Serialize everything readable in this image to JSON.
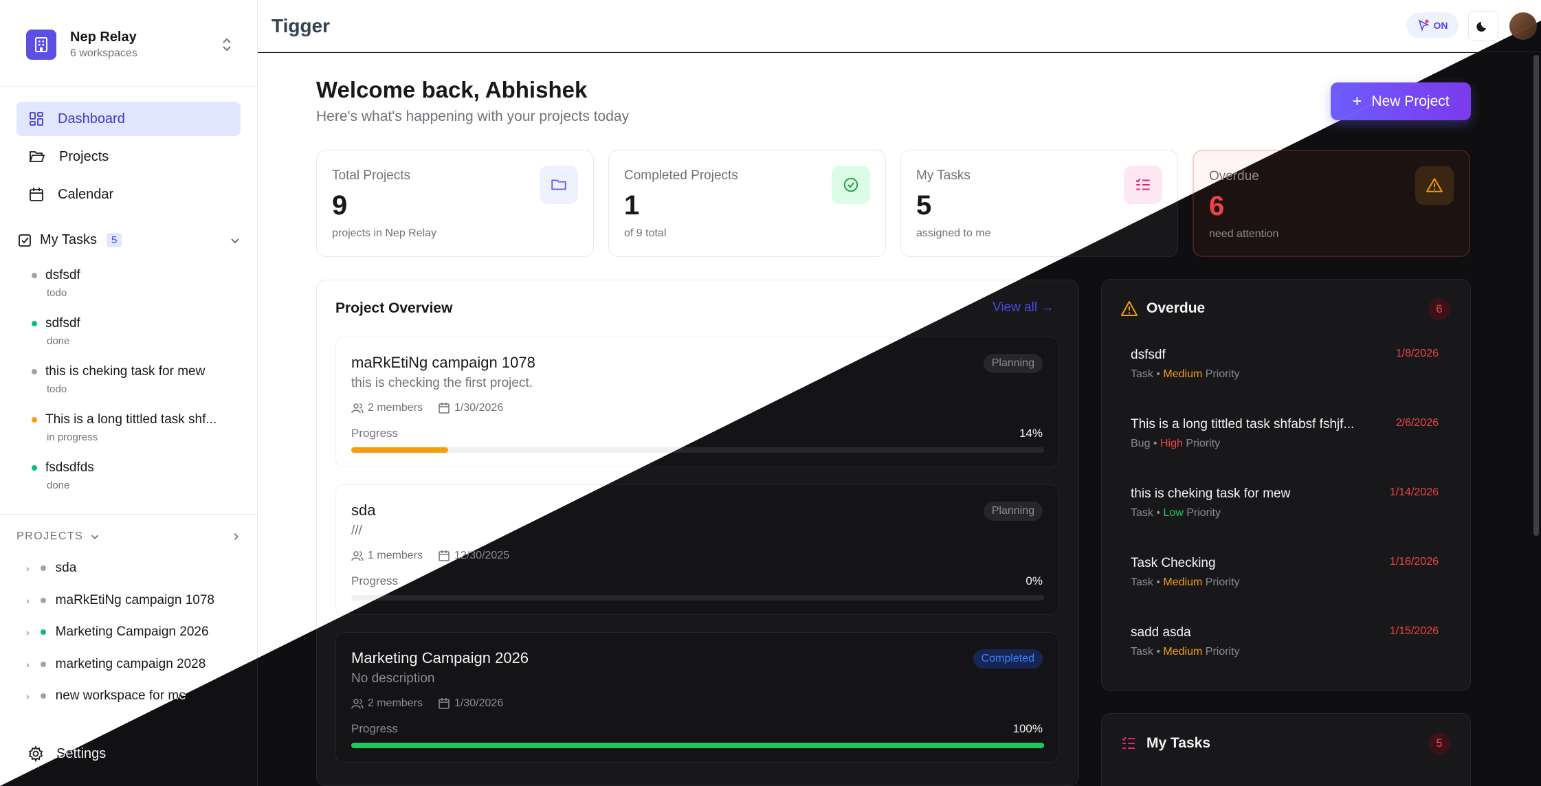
{
  "workspace": {
    "name": "Nep Relay",
    "sub": "6 workspaces"
  },
  "nav": {
    "dashboard": "Dashboard",
    "projects": "Projects",
    "calendar": "Calendar"
  },
  "my_tasks": {
    "label": "My Tasks",
    "count": "5",
    "items": [
      {
        "title": "dsfsdf",
        "status": "todo",
        "color": "#9ca3af"
      },
      {
        "title": "sdfsdf",
        "status": "done",
        "color": "#10b981"
      },
      {
        "title": "this is cheking task for mew",
        "status": "todo",
        "color": "#9ca3af"
      },
      {
        "title": "This is a long tittled task shf...",
        "status": "in progress",
        "color": "#f59e0b"
      },
      {
        "title": "fsdsdfds",
        "status": "done",
        "color": "#10b981"
      }
    ]
  },
  "projects_section": {
    "label": "PROJECTS",
    "items": [
      {
        "name": "sda",
        "color": "#9ca3af"
      },
      {
        "name": "maRkEtiNg campaign 1078",
        "color": "#9ca3af"
      },
      {
        "name": "Marketing Campaign 2026",
        "color": "#10b981"
      },
      {
        "name": "marketing campaign 2028",
        "color": "#9ca3af"
      },
      {
        "name": "new workspace for me",
        "color": "#9ca3af"
      }
    ]
  },
  "settings": "Settings",
  "app_title": "Tigger",
  "header": {
    "on_label": "ON"
  },
  "welcome": {
    "title": "Welcome back, Abhishek",
    "subtitle": "Here's what's happening with your projects today"
  },
  "new_project": "New Project",
  "stats": [
    {
      "label": "Total Projects",
      "value": "9",
      "foot": "projects in Nep Relay",
      "icon": "folder-icon"
    },
    {
      "label": "Completed Projects",
      "value": "1",
      "foot": "of 9 total",
      "icon": "check-circle-icon"
    },
    {
      "label": "My Tasks",
      "value": "5",
      "foot": "assigned to me",
      "icon": "task-list-icon"
    },
    {
      "label": "Overdue",
      "value": "6",
      "foot": "need attention",
      "icon": "warning-icon"
    }
  ],
  "overview": {
    "title": "Project Overview",
    "view_all": "View all →",
    "progress_label": "Progress",
    "projects": [
      {
        "name": "maRkEtiNg campaign 1078",
        "desc": "this is checking the first project.",
        "members": "2 members",
        "date": "1/30/2026",
        "status": "Planning",
        "progress": 14,
        "progress_text": "14%",
        "color": "#f59e0b"
      },
      {
        "name": "sda",
        "desc": "///",
        "members": "1 members",
        "date": "12/30/2025",
        "status": "Planning",
        "progress": 0,
        "progress_text": "0%",
        "color": "#f59e0b"
      },
      {
        "name": "Marketing Campaign 2026",
        "desc": "No description",
        "members": "2 members",
        "date": "1/30/2026",
        "status": "Completed",
        "progress": 100,
        "progress_text": "100%",
        "color": "#22c55e"
      }
    ]
  },
  "overdue": {
    "title": "Overdue",
    "count": "6",
    "priority_word": "Priority",
    "items": [
      {
        "title": "dsfsdf",
        "type": "Task",
        "priority": "Medium",
        "date": "1/8/2026"
      },
      {
        "title": "This is a long tittled task shfabsf fshjf...",
        "type": "Bug",
        "priority": "High",
        "date": "2/6/2026"
      },
      {
        "title": "this is cheking task for mew",
        "type": "Task",
        "priority": "Low",
        "date": "1/14/2026"
      },
      {
        "title": "Task Checking",
        "type": "Task",
        "priority": "Medium",
        "date": "1/16/2026"
      },
      {
        "title": "sadd asda",
        "type": "Task",
        "priority": "Medium",
        "date": "1/15/2026"
      }
    ]
  },
  "my_tasks_panel": {
    "title": "My Tasks",
    "count": "5"
  }
}
